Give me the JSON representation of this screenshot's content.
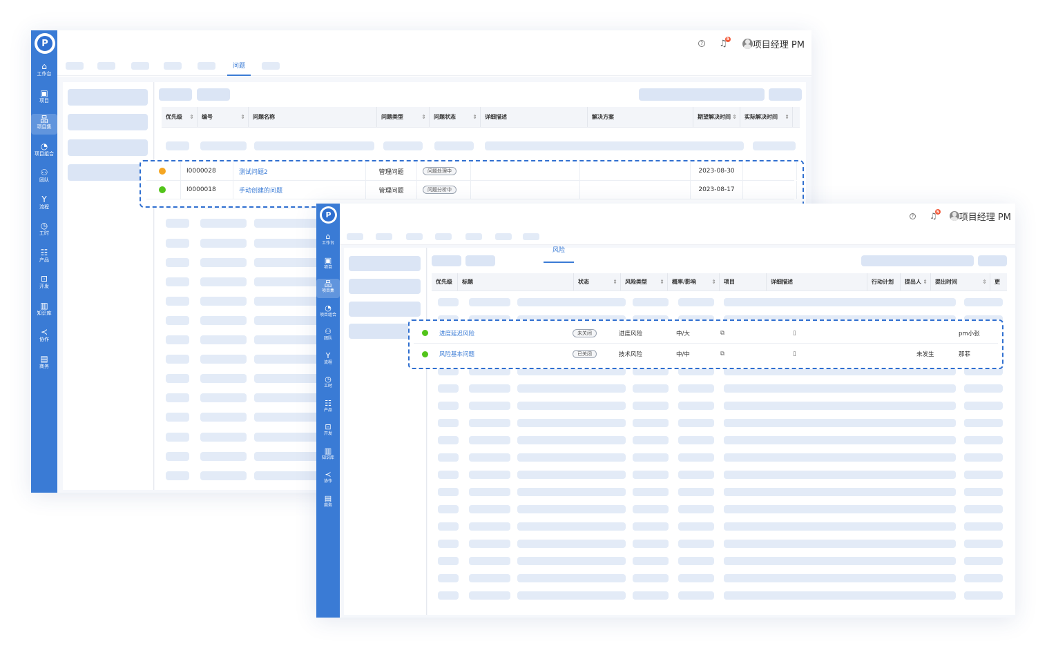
{
  "colors": {
    "brand": "#3a7bd5",
    "sidebar": "#3a7bd5",
    "link": "#3a7bd5",
    "priority_orange": "#f5a623",
    "priority_green": "#52c41a",
    "badge_red": "#f25a3a"
  },
  "sidebar": {
    "logo": "P",
    "items": [
      {
        "label": "工作台",
        "icon": "home-icon",
        "glyph": "⌂"
      },
      {
        "label": "项目",
        "icon": "board-icon",
        "glyph": "▣"
      },
      {
        "label": "项目集",
        "icon": "hierarchy-icon",
        "glyph": "品",
        "active": true
      },
      {
        "label": "项目组合",
        "icon": "dashboard-icon",
        "glyph": "◔"
      },
      {
        "label": "团队",
        "icon": "team-icon",
        "glyph": "⚇"
      },
      {
        "label": "流程",
        "icon": "flow-icon",
        "glyph": "Y"
      },
      {
        "label": "工时",
        "icon": "clock-icon",
        "glyph": "◷"
      },
      {
        "label": "产品",
        "icon": "product-icon",
        "glyph": "☷"
      },
      {
        "label": "开发",
        "icon": "terminal-icon",
        "glyph": "⊡"
      },
      {
        "label": "知识库",
        "icon": "book-icon",
        "glyph": "▥"
      },
      {
        "label": "协作",
        "icon": "share-icon",
        "glyph": "≺"
      },
      {
        "label": "商务",
        "icon": "contract-icon",
        "glyph": "▤"
      }
    ]
  },
  "header": {
    "help_icon": "?",
    "notification_count": "5",
    "user_name": "项目经理 PM"
  },
  "issues_window": {
    "active_tab": "问题",
    "columns": [
      {
        "label": "优先级",
        "sortable": true
      },
      {
        "label": "编号",
        "sortable": true
      },
      {
        "label": "问题名称",
        "sortable": false
      },
      {
        "label": "问题类型",
        "sortable": true
      },
      {
        "label": "问题状态",
        "sortable": true
      },
      {
        "label": "详细描述",
        "sortable": false
      },
      {
        "label": "解决方案",
        "sortable": false
      },
      {
        "label": "期望解决时间",
        "sortable": true
      },
      {
        "label": "实际解决时间",
        "sortable": true
      }
    ],
    "rows": [
      {
        "priority": "orange",
        "id": "I0000028",
        "name": "测试问题2",
        "type": "管理问题",
        "status": "问题处理中",
        "expected_date": "2023-08-30"
      },
      {
        "priority": "green",
        "id": "I0000018",
        "name": "手动创建的问题",
        "type": "管理问题",
        "status": "问题分析中",
        "expected_date": "2023-08-17"
      }
    ]
  },
  "risks_window": {
    "active_tab": "风险",
    "columns": [
      {
        "label": "优先级",
        "sortable": false
      },
      {
        "label": "标题",
        "sortable": false
      },
      {
        "label": "状态",
        "sortable": true
      },
      {
        "label": "风险类型",
        "sortable": true
      },
      {
        "label": "概率/影响",
        "sortable": true
      },
      {
        "label": "项目",
        "sortable": false
      },
      {
        "label": "详细描述",
        "sortable": false
      },
      {
        "label": "行动计划",
        "sortable": false
      },
      {
        "label": "提出人",
        "sortable": true
      },
      {
        "label": "提出时间",
        "sortable": true
      },
      {
        "label": "更",
        "sortable": false
      }
    ],
    "rows": [
      {
        "priority": "green",
        "title": "进度延迟风险",
        "status": "未关闭",
        "type": "进度风险",
        "prob_impact": "中/大",
        "project_icon": "copy-icon",
        "desc_icon": "document-icon",
        "action_plan": "",
        "proposer": "pm小张",
        "time": ""
      },
      {
        "priority": "green",
        "title": "风险基本问题",
        "status": "已关闭",
        "type": "技术风险",
        "prob_impact": "中/中",
        "project_icon": "copy-icon",
        "desc_icon": "document-icon",
        "action_plan": "未发生",
        "proposer": "那菲",
        "time": ""
      }
    ]
  }
}
